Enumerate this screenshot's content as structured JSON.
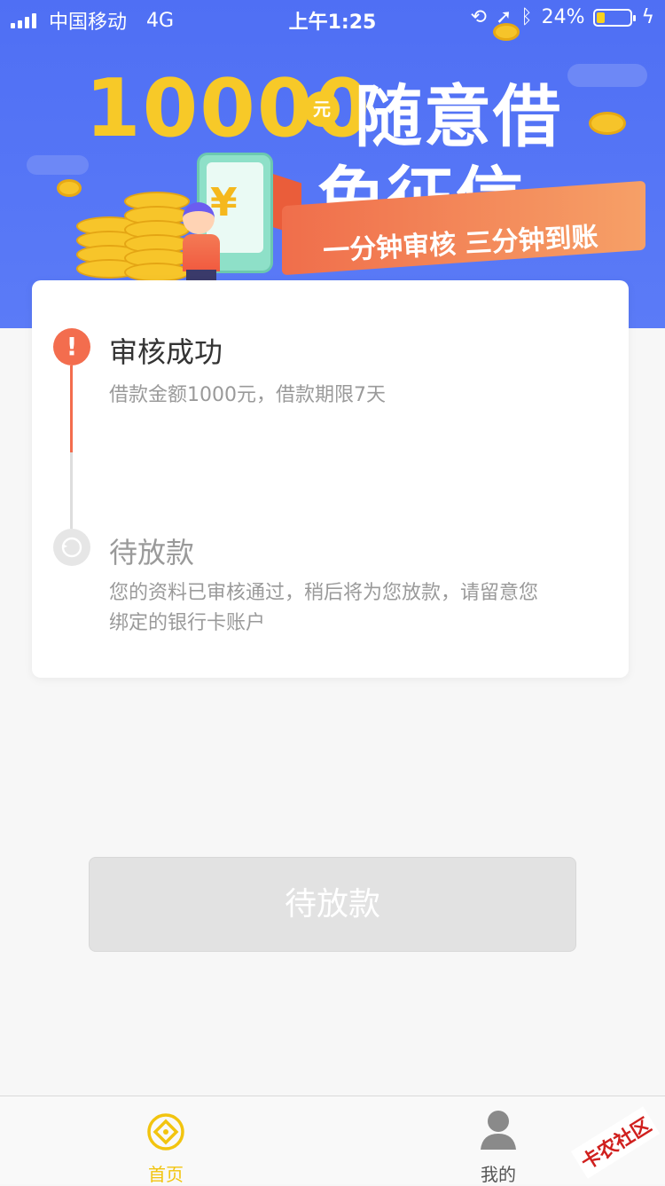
{
  "status_bar": {
    "carrier": "中国移动",
    "network": "4G",
    "time": "上午1:25",
    "battery": "24%"
  },
  "banner": {
    "amount": "10000",
    "amount_unit": "元",
    "slogan_line1": "随意借",
    "slogan_line2": "免征信",
    "ribbon_text": "一分钟审核 三分钟到账"
  },
  "progress": {
    "steps": [
      {
        "title": "审核成功",
        "desc": "借款金额1000元，借款期限7天"
      },
      {
        "title": "待放款",
        "desc": "您的资料已审核通过，稍后将为您放款，请留意您绑定的银行卡账户"
      }
    ]
  },
  "action": {
    "button_label": "待放款"
  },
  "tabbar": {
    "home_label": "首页",
    "mine_label": "我的"
  },
  "watermark": "卡农社区",
  "colors": {
    "banner_bg": "#5372f5",
    "accent": "#f2c40f",
    "active_step": "#f36d4e",
    "disabled_button": "#e2e2e2"
  }
}
